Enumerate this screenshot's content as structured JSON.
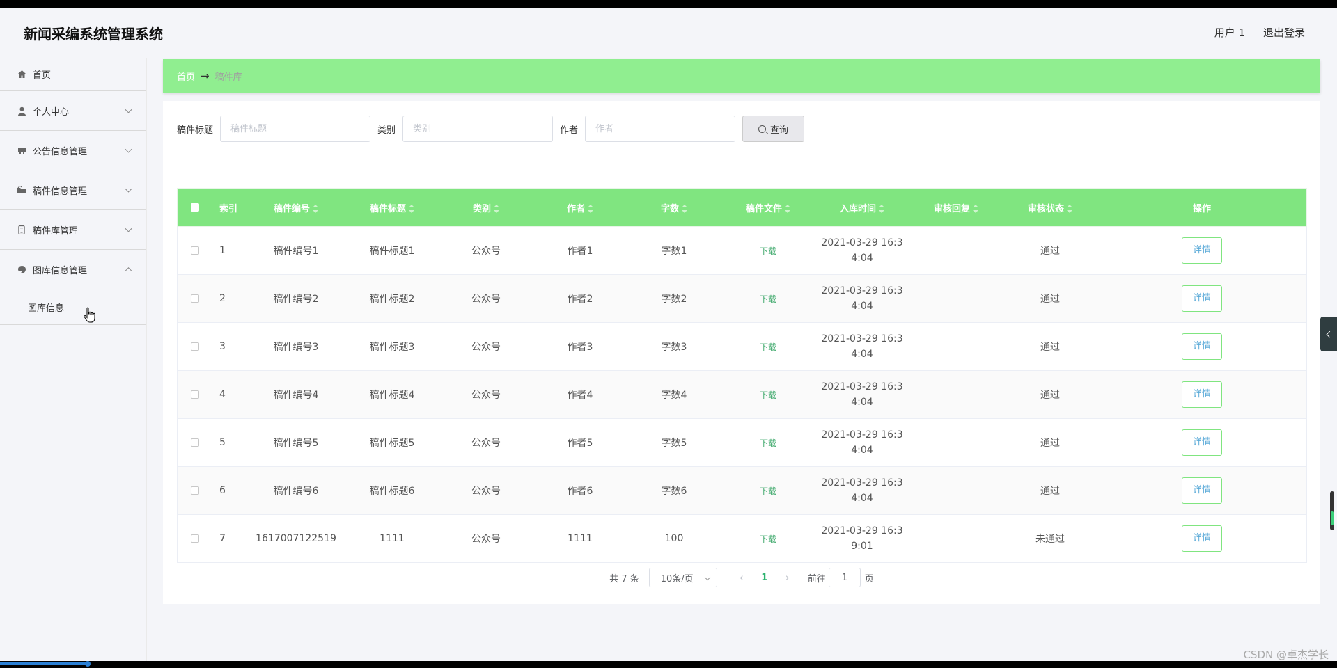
{
  "header": {
    "title": "新闻采编系统管理系统",
    "user": "用户 1",
    "logout": "退出登录"
  },
  "sidebar": {
    "items": [
      {
        "label": "首页",
        "icon": "home-icon"
      },
      {
        "label": "个人中心",
        "icon": "user-icon"
      },
      {
        "label": "公告信息管理",
        "icon": "notice-icon"
      },
      {
        "label": "稿件信息管理",
        "icon": "manuscript-icon"
      },
      {
        "label": "稿件库管理",
        "icon": "library-icon"
      },
      {
        "label": "图库信息管理",
        "icon": "gallery-icon"
      }
    ],
    "sub_items": [
      {
        "label": "图库信息"
      }
    ]
  },
  "breadcrumb": {
    "home": "首页",
    "arrow": "→",
    "current": "稿件库"
  },
  "search": {
    "title_label": "稿件标题",
    "title_placeholder": "稿件标题",
    "category_label": "类别",
    "category_placeholder": "类别",
    "author_label": "作者",
    "author_placeholder": "作者",
    "query_button": "查询"
  },
  "table": {
    "columns": [
      "索引",
      "稿件编号",
      "稿件标题",
      "类别",
      "作者",
      "字数",
      "稿件文件",
      "入库时间",
      "审核回复",
      "审核状态",
      "操作"
    ],
    "download_label": "下载",
    "detail_label": "详情",
    "rows": [
      {
        "index": "1",
        "code": "稿件编号1",
        "title": "稿件标题1",
        "category": "公众号",
        "author": "作者1",
        "words": "字数1",
        "time_a": "2021-03-29 16:3",
        "time_b": "4:04",
        "reply": "",
        "status": "通过"
      },
      {
        "index": "2",
        "code": "稿件编号2",
        "title": "稿件标题2",
        "category": "公众号",
        "author": "作者2",
        "words": "字数2",
        "time_a": "2021-03-29 16:3",
        "time_b": "4:04",
        "reply": "",
        "status": "通过"
      },
      {
        "index": "3",
        "code": "稿件编号3",
        "title": "稿件标题3",
        "category": "公众号",
        "author": "作者3",
        "words": "字数3",
        "time_a": "2021-03-29 16:3",
        "time_b": "4:04",
        "reply": "",
        "status": "通过"
      },
      {
        "index": "4",
        "code": "稿件编号4",
        "title": "稿件标题4",
        "category": "公众号",
        "author": "作者4",
        "words": "字数4",
        "time_a": "2021-03-29 16:3",
        "time_b": "4:04",
        "reply": "",
        "status": "通过"
      },
      {
        "index": "5",
        "code": "稿件编号5",
        "title": "稿件标题5",
        "category": "公众号",
        "author": "作者5",
        "words": "字数5",
        "time_a": "2021-03-29 16:3",
        "time_b": "4:04",
        "reply": "",
        "status": "通过"
      },
      {
        "index": "6",
        "code": "稿件编号6",
        "title": "稿件标题6",
        "category": "公众号",
        "author": "作者6",
        "words": "字数6",
        "time_a": "2021-03-29 16:3",
        "time_b": "4:04",
        "reply": "",
        "status": "通过"
      },
      {
        "index": "7",
        "code": "1617007122519",
        "title": "1111",
        "category": "公众号",
        "author": "1111",
        "words": "100",
        "time_a": "2021-03-29 16:3",
        "time_b": "9:01",
        "reply": "",
        "status": "未通过"
      }
    ]
  },
  "pagination": {
    "total": "共 7 条",
    "page_size": "10条/页",
    "current_page": "1",
    "goto_label": "前往",
    "goto_value": "1",
    "page_unit": "页"
  },
  "watermark": "CSDN @卓杰学长",
  "colors": {
    "accent_green": "#80e580",
    "breadcrumb_green": "#90ee90",
    "link_blue": "#5aaad8"
  }
}
